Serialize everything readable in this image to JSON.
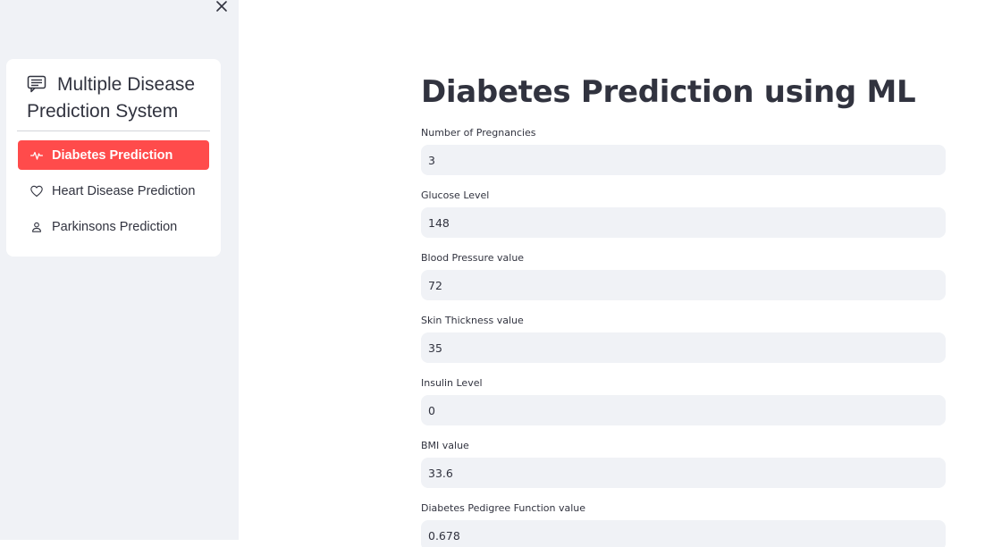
{
  "sidebar": {
    "title": "Multiple Disease Prediction System",
    "items": [
      {
        "label": "Diabetes Prediction",
        "icon": "activity-icon",
        "active": true
      },
      {
        "label": "Heart Disease Prediction",
        "icon": "heart-icon",
        "active": false
      },
      {
        "label": "Parkinsons Prediction",
        "icon": "person-icon",
        "active": false
      }
    ]
  },
  "main": {
    "title": "Diabetes Prediction using ML",
    "fields": [
      {
        "label": "Number of Pregnancies",
        "value": "3"
      },
      {
        "label": "Glucose Level",
        "value": "148"
      },
      {
        "label": "Blood Pressure value",
        "value": "72"
      },
      {
        "label": "Skin Thickness value",
        "value": "35"
      },
      {
        "label": "Insulin Level",
        "value": "0"
      },
      {
        "label": "BMI value",
        "value": "33.6"
      },
      {
        "label": "Diabetes Pedigree Function value",
        "value": "0.678"
      }
    ]
  },
  "colors": {
    "accent": "#ff4b4b",
    "sidebar_bg": "#f0f2f6",
    "input_bg": "#f0f2f6",
    "text": "#31333f"
  }
}
